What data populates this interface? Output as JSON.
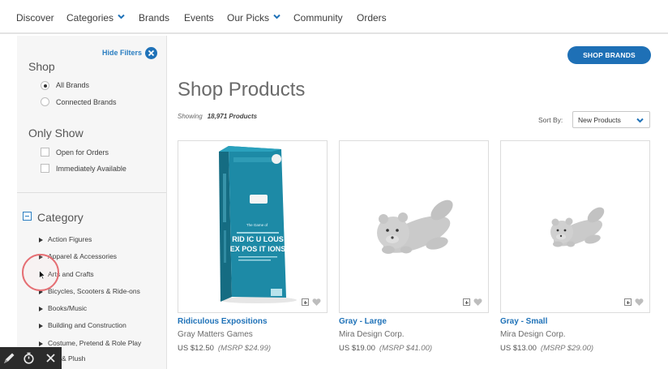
{
  "nav": {
    "items": [
      "Discover",
      "Categories",
      "Brands",
      "Events",
      "Our Picks",
      "Community",
      "Orders"
    ]
  },
  "filters": {
    "hide_label": "Hide Filters",
    "shop_title": "Shop",
    "shop_options": [
      {
        "label": "All Brands",
        "selected": true
      },
      {
        "label": "Connected Brands",
        "selected": false
      }
    ],
    "only_show_title": "Only Show",
    "only_show_options": [
      {
        "label": "Open for Orders",
        "checked": false
      },
      {
        "label": "Immediately Available",
        "checked": false
      }
    ],
    "category_title": "Category",
    "categories": [
      "Action Figures",
      "Apparel & Accessories",
      "Arts and Crafts",
      "Bicycles, Scooters & Ride-ons",
      "Books/Music",
      "Building and Construction",
      "Costume, Pretend & Role Play",
      "& Plush"
    ]
  },
  "main": {
    "shop_brands_label": "SHOP BRANDS",
    "title": "Shop Products",
    "showing_label": "Showing",
    "showing_count": "18,971 Products",
    "sort_label": "Sort By:",
    "sort_value": "New Products"
  },
  "products": [
    {
      "name": "Ridiculous Expositions",
      "brand": "Gray Matters Games",
      "price": "US $12.50",
      "msrp": "(MSRP $24.99)",
      "box_text_1": "RID IC U LOUS",
      "box_text_2": "EX POS IT IONS"
    },
    {
      "name": "Gray - Large",
      "brand": "Mira Design Corp.",
      "price": "US $19.00",
      "msrp": "(MSRP $41.00)"
    },
    {
      "name": "Gray - Small",
      "brand": "Mira Design Corp.",
      "price": "US $13.00",
      "msrp": "(MSRP $29.00)"
    }
  ],
  "colors": {
    "accent_blue": "#1e70b6",
    "link_blue": "#2a7ec1",
    "box_teal": "#1d8aa6",
    "plush_gray": "#c9c9c9"
  },
  "icons": [
    "chevron-down-icon",
    "close-circle-icon",
    "plus-box-icon",
    "heart-icon",
    "cursor-icon",
    "pen-icon",
    "timer-icon",
    "close-icon"
  ]
}
